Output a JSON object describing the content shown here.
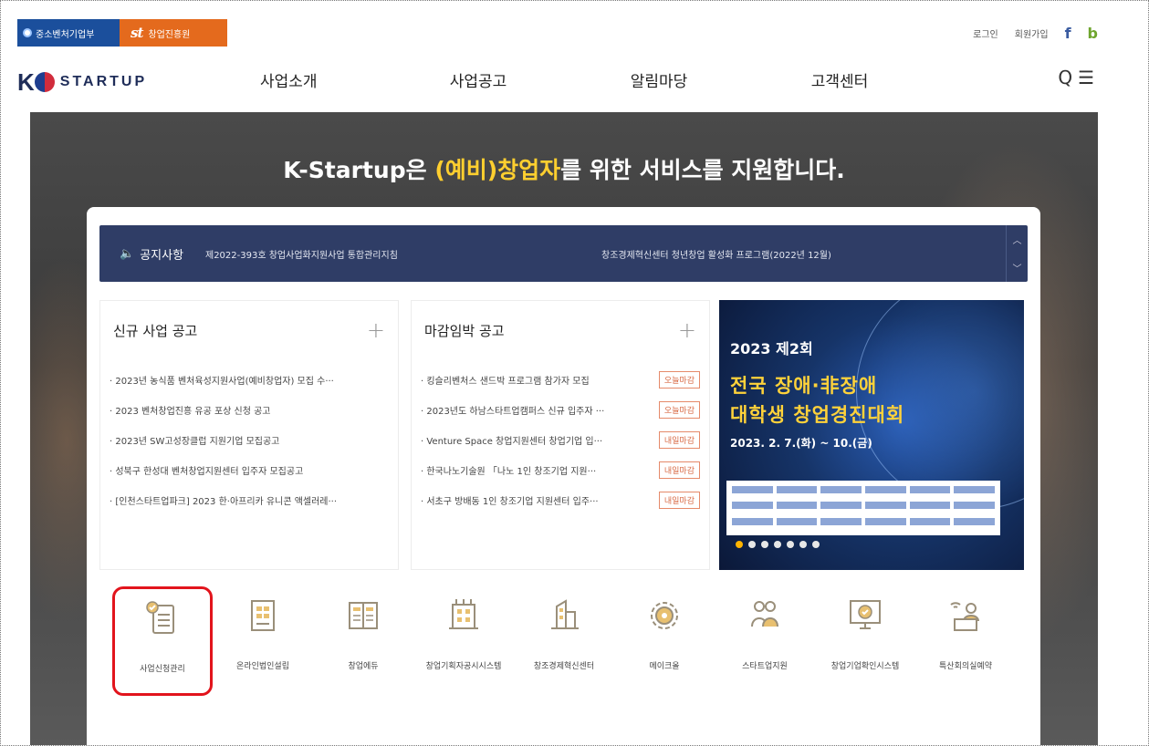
{
  "util": {
    "org1": "중소벤처기업부",
    "org2_mark": "st",
    "org2": "창업진흥원",
    "login": "로그인",
    "join": "회원가입",
    "sns1": "f",
    "sns2": "b"
  },
  "header": {
    "logo_k": "K",
    "logo_word": "STARTUP",
    "menu": [
      "사업소개",
      "사업공고",
      "알림마당",
      "고객센터"
    ],
    "search_glyph": "Q",
    "menu_glyph": "☰"
  },
  "hero": {
    "title_a": "K-Startup은 ",
    "title_hl": "(예비)창업자",
    "title_b": "를 위한 서비스를 지원합니다."
  },
  "notice": {
    "label": "공지사항",
    "items": [
      "제2022-393호 창업사업화지원사업 통합관리지침",
      "창조경제혁신센터 청년창업 활성화 프로그램(2022년 12월)"
    ]
  },
  "new_box": {
    "title": "신규 사업 공고",
    "items": [
      "· 2023년 농식품 벤처육성지원사업(예비창업자) 모집 수···",
      "· 2023 벤처창업진흥 유공 포상 신청 공고",
      "· 2023년 SW고성장클럽 지원기업 모집공고",
      "· 성북구 한성대 벤처창업지원센터 입주자 모집공고",
      "· [인천스타트업파크] 2023 한·아프리카 유니콘 액셀러레···"
    ]
  },
  "end_box": {
    "title": "마감임박 공고",
    "items": [
      {
        "text": "· 킹슬리벤처스 샌드박 프로그램 참가자 모집",
        "badge": "오늘마감"
      },
      {
        "text": "· 2023년도 하남스타트업캠퍼스 신규 입주자 ···",
        "badge": "오늘마감"
      },
      {
        "text": "· Venture Space 창업지원센터 창업기업 입···",
        "badge": "내일마감"
      },
      {
        "text": "· 한국나노기술원 「나노 1인 창조기업 지원···",
        "badge": "내일마감"
      },
      {
        "text": "· 서초구 방배동 1인 창조기업 지원센터 입주···",
        "badge": "내일마감"
      }
    ]
  },
  "banner": {
    "line1": "2023 제2회",
    "line2": "전국 장애·非장애",
    "line3": "대학생 창업경진대회",
    "line4": "2023. 2. 7.(화) ~ 10.(금)"
  },
  "quick": [
    {
      "label": "사업신청관리",
      "icon": "checklist-icon",
      "selected": true
    },
    {
      "label": "온라인법인설립",
      "icon": "building-doc-icon"
    },
    {
      "label": "창업에듀",
      "icon": "book-icon"
    },
    {
      "label": "창업기획자공시시스템",
      "icon": "office-icon"
    },
    {
      "label": "창조경제혁신센터",
      "icon": "tower-icon"
    },
    {
      "label": "메이크올",
      "icon": "gear-icon"
    },
    {
      "label": "스타트업지원",
      "icon": "people-icon"
    },
    {
      "label": "창업기업확인시스템",
      "icon": "monitor-check-icon"
    },
    {
      "label": "특산회의실예약",
      "icon": "reservation-icon"
    }
  ],
  "colors": {
    "notice_bg": "#2f3d66",
    "org1_bg": "#1b4f9c",
    "org2_bg": "#e46a1d",
    "highlight": "#ffcf2f",
    "selection": "#e2141c",
    "icon_line": "#9a8f7a",
    "icon_fill": "#e8c070"
  }
}
